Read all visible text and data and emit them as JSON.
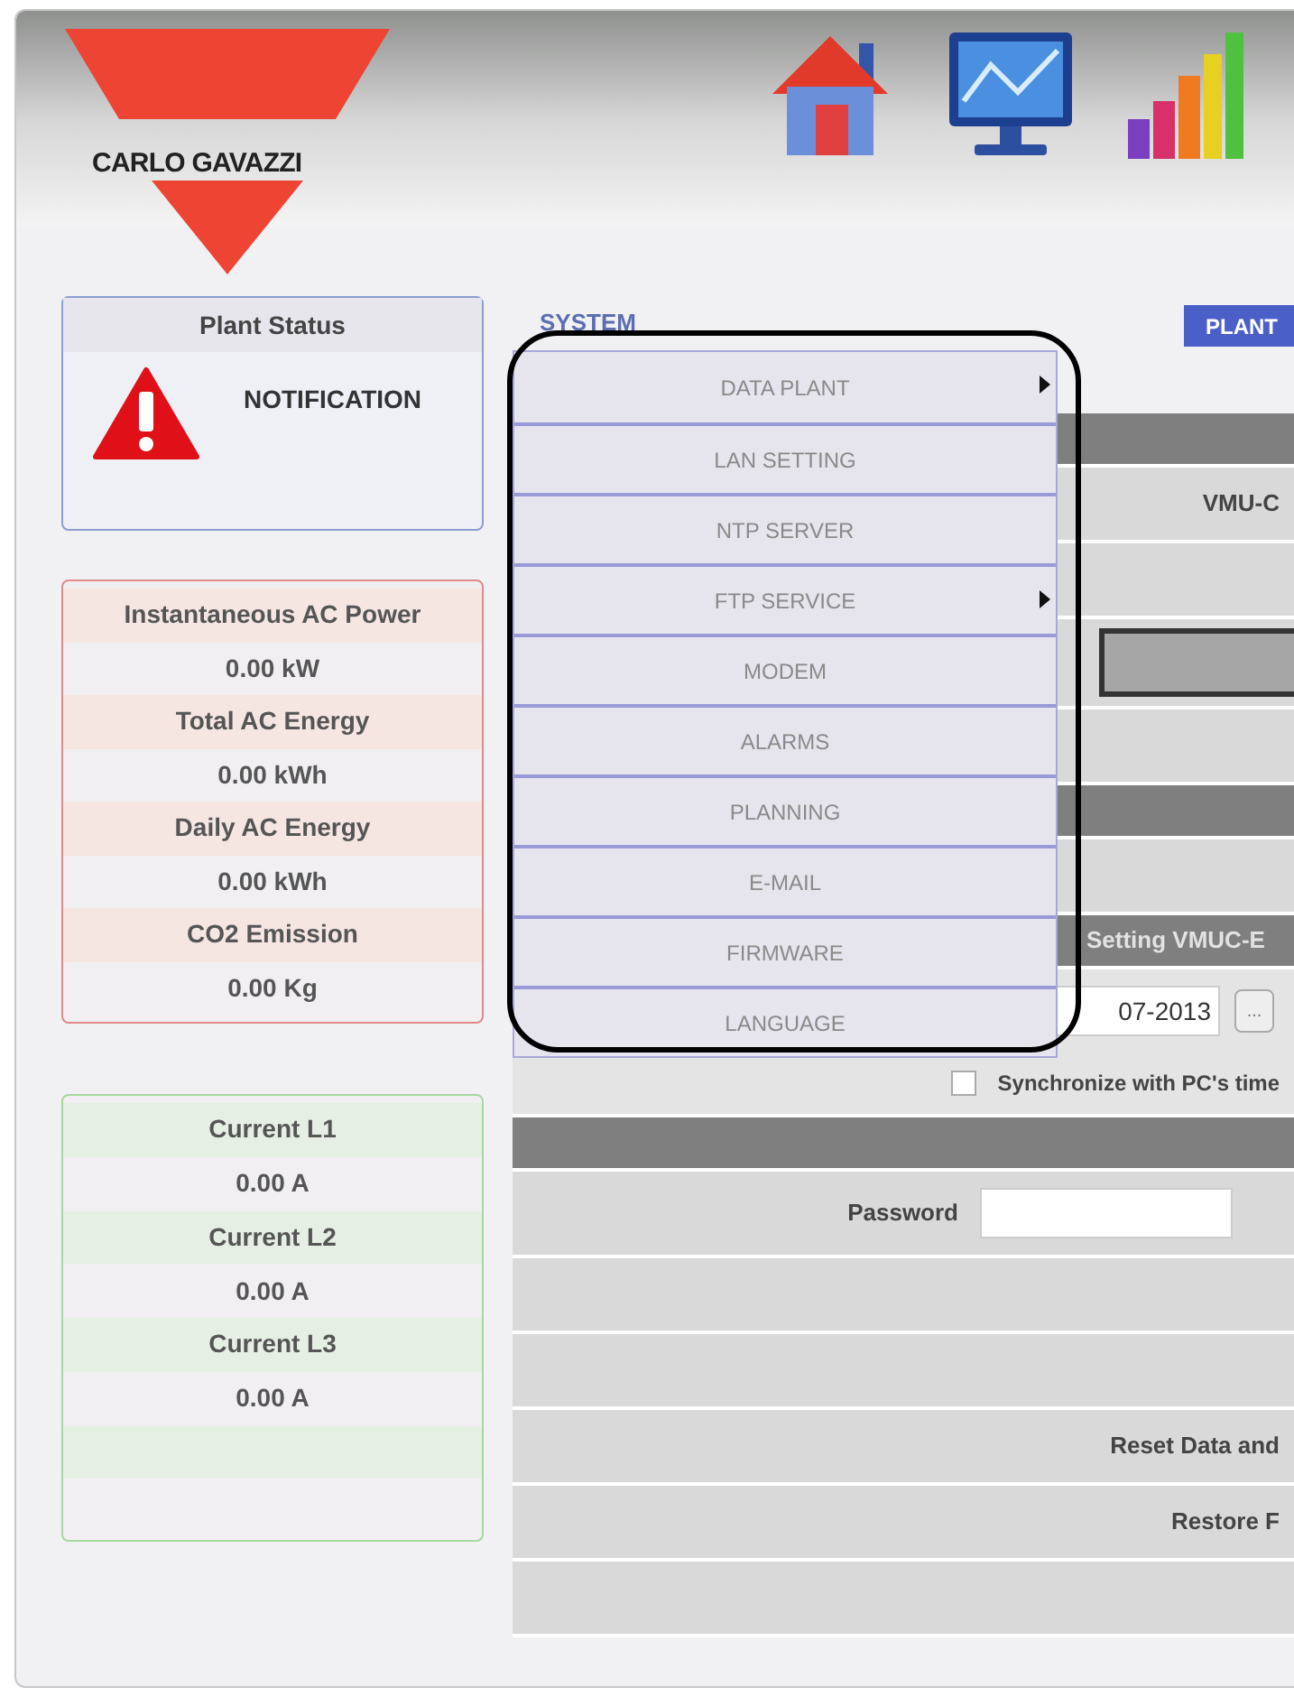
{
  "header": {
    "logo_text": "CARLO GAVAZZI"
  },
  "plant_status": {
    "title": "Plant Status",
    "status": "NOTIFICATION"
  },
  "energy_panel": [
    {
      "label": "Instantaneous AC Power",
      "value": "0.00 kW"
    },
    {
      "label": "Total AC Energy",
      "value": "0.00 kWh"
    },
    {
      "label": "Daily AC Energy",
      "value": "0.00 kWh"
    },
    {
      "label": "CO2 Emission",
      "value": "0.00 Kg"
    }
  ],
  "current_panel": [
    {
      "label": "Current L1",
      "value": "0.00 A"
    },
    {
      "label": "Current L2",
      "value": "0.00 A"
    },
    {
      "label": "Current L3",
      "value": "0.00 A"
    }
  ],
  "section_title": "SYSTEM",
  "tab": {
    "label": "PLANT",
    "selected": true
  },
  "system_menu": [
    {
      "label": "DATA PLANT",
      "has_submenu": true
    },
    {
      "label": "LAN SETTING",
      "has_submenu": false
    },
    {
      "label": "NTP SERVER",
      "has_submenu": false
    },
    {
      "label": "FTP SERVICE",
      "has_submenu": true
    },
    {
      "label": "MODEM",
      "has_submenu": false
    },
    {
      "label": "ALARMS",
      "has_submenu": false
    },
    {
      "label": "PLANNING",
      "has_submenu": false
    },
    {
      "label": "E-MAIL",
      "has_submenu": false
    },
    {
      "label": "FIRMWARE",
      "has_submenu": false
    },
    {
      "label": "LANGUAGE",
      "has_submenu": false
    }
  ],
  "rows": [
    {
      "kind": "header"
    },
    {
      "kind": "text",
      "text": "VMU-C"
    },
    {
      "kind": "blank"
    },
    {
      "kind": "box"
    },
    {
      "kind": "blank"
    },
    {
      "kind": "header"
    },
    {
      "kind": "blank"
    },
    {
      "kind": "header",
      "text": "Setting VMUC-E"
    },
    {
      "kind": "date",
      "value": "07-2013",
      "button_label": "..."
    },
    {
      "kind": "checkbox",
      "label": "Synchronize with PC's time",
      "checked": false
    },
    {
      "kind": "header"
    },
    {
      "kind": "password",
      "label": "Password"
    },
    {
      "kind": "blank"
    },
    {
      "kind": "blank"
    },
    {
      "kind": "text",
      "text": "Reset Data and"
    },
    {
      "kind": "text",
      "text": "Restore F"
    },
    {
      "kind": "blank"
    }
  ]
}
